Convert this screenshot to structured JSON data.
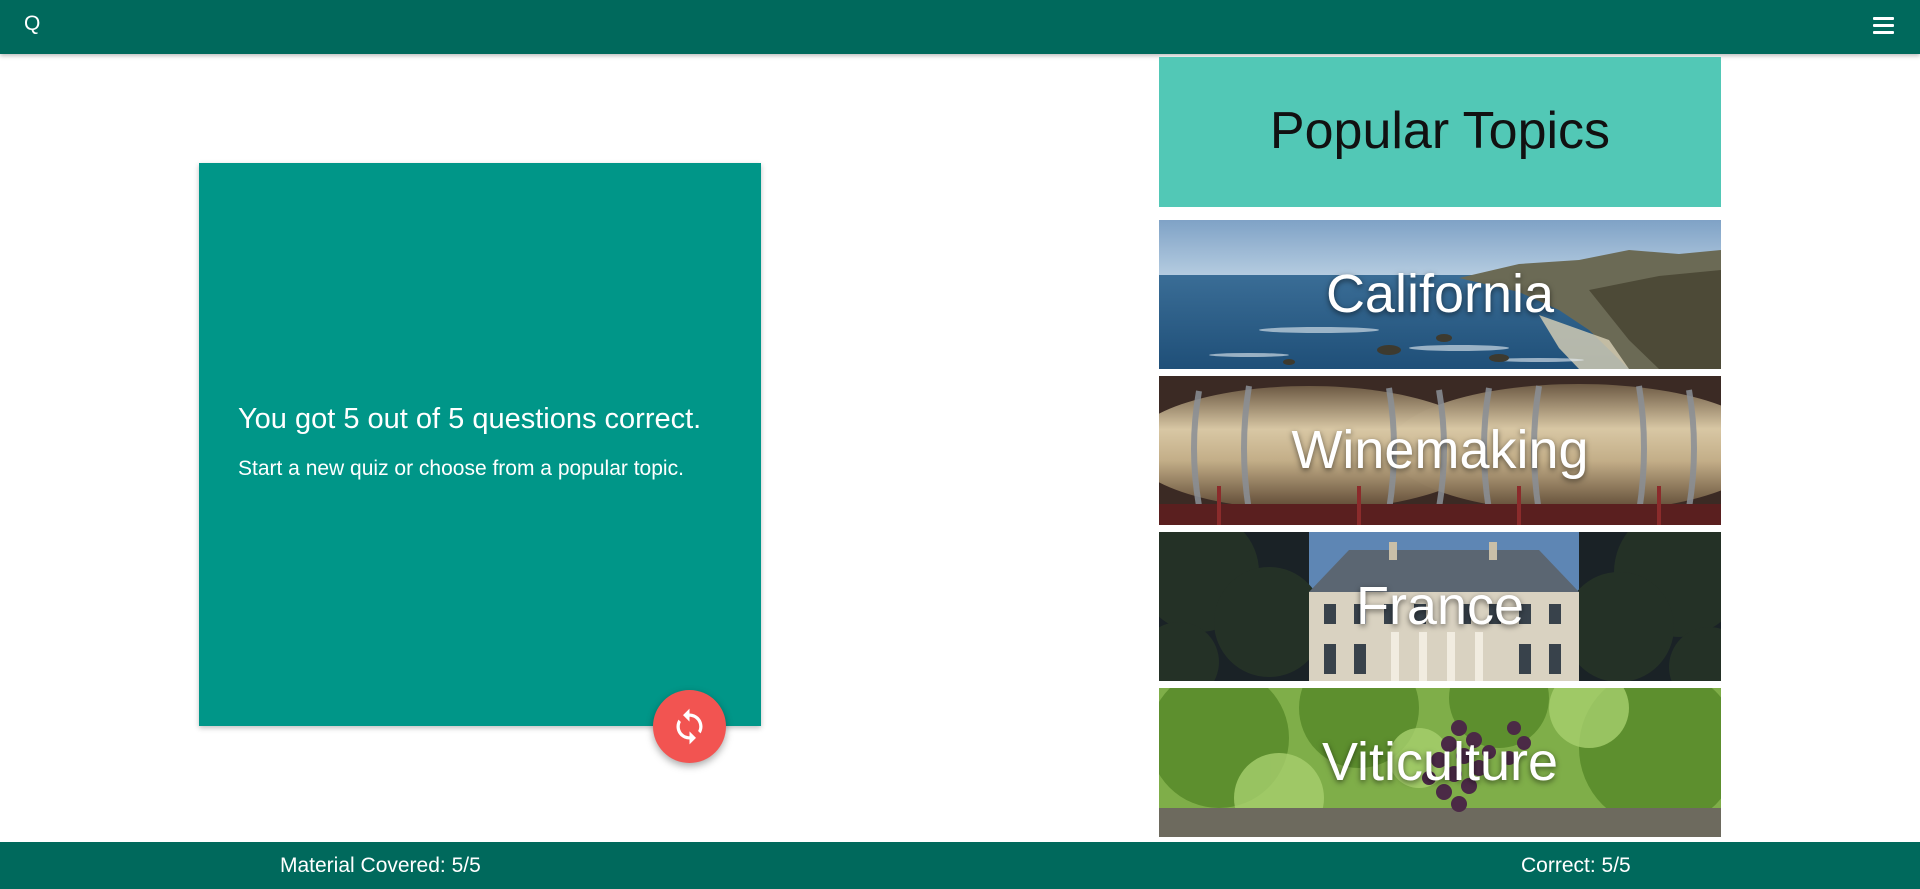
{
  "app": {
    "brand": "Q",
    "menu_icon": "hamburger-menu-icon"
  },
  "quiz": {
    "result": "You got 5 out of 5 questions correct.",
    "prompt": "Start a new quiz or choose from a popular topic.",
    "restart_icon": "refresh-icon"
  },
  "topics": {
    "title": "Popular Topics",
    "items": [
      {
        "label": "California"
      },
      {
        "label": "Winemaking"
      },
      {
        "label": "France"
      },
      {
        "label": "Viticulture"
      }
    ]
  },
  "footer": {
    "material_covered": "Material Covered: 5/5",
    "correct": "Correct: 5/5"
  },
  "colors": {
    "primary_dark": "#00695c",
    "card": "#009688",
    "topics_header": "#52c8b6",
    "fab": "#f25451"
  }
}
